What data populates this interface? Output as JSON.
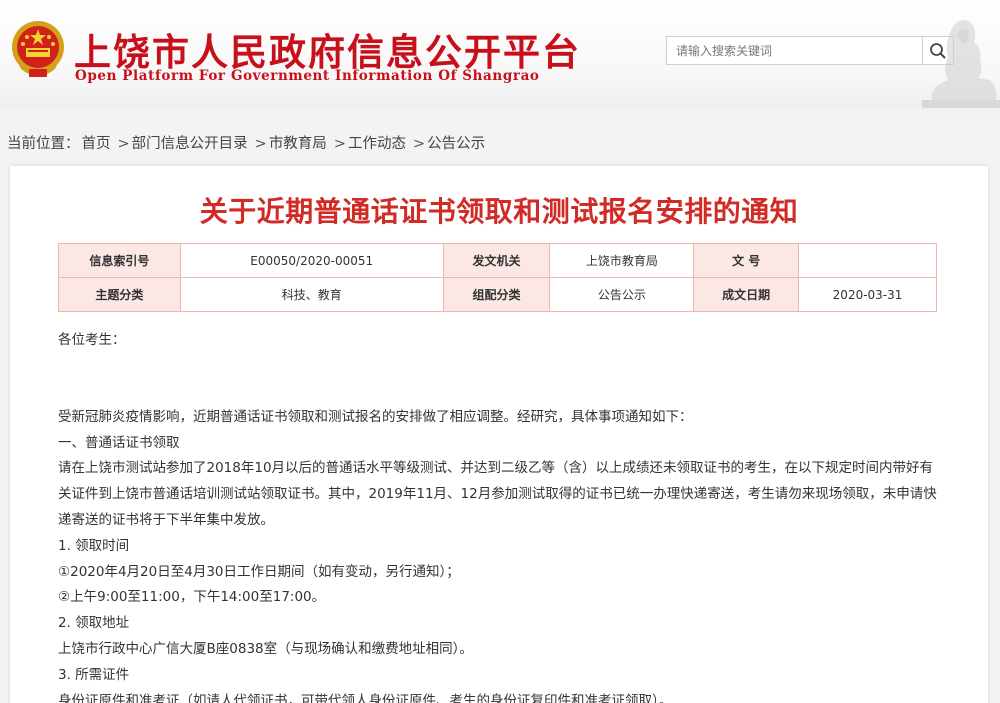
{
  "header": {
    "title": "上饶市人民政府信息公开平台",
    "subtitle": "Open Platform For Government Information Of Shangrao",
    "search_placeholder": "请输入搜索关键词",
    "colors": {
      "brand_red": "#c8101a"
    }
  },
  "breadcrumb": {
    "prefix": "当前位置：",
    "items": [
      "首页",
      "部门信息公开目录",
      "市教育局",
      "工作动态",
      "公告公示"
    ],
    "separator": ">"
  },
  "article": {
    "title": "关于近期普通话证书领取和测试报名安排的通知",
    "meta": [
      [
        {
          "label": "信息索引号",
          "value": "E00050/2020-00051"
        },
        {
          "label": "发文机关",
          "value": "上饶市教育局"
        },
        {
          "label": "文 号",
          "value": ""
        }
      ],
      [
        {
          "label": "主题分类",
          "value": "科技、教育"
        },
        {
          "label": "组配分类",
          "value": "公告公示"
        },
        {
          "label": "成文日期",
          "value": "2020-03-31"
        }
      ]
    ],
    "greeting": "各位考生：",
    "paragraphs": [
      "受新冠肺炎疫情影响，近期普通话证书领取和测试报名的安排做了相应调整。经研究，具体事项通知如下：",
      "一、普通话证书领取",
      "请在上饶市测试站参加了2018年10月以后的普通话水平等级测试、并达到二级乙等（含）以上成绩还未领取证书的考生，在以下规定时间内带好有关证件到上饶市普通话培训测试站领取证书。其中，2019年11月、12月参加测试取得的证书已统一办理快递寄送，考生请勿来现场领取，未申请快递寄送的证书将于下半年集中发放。",
      "1. 领取时间",
      "①2020年4月20日至4月30日工作日期间（如有变动，另行通知）；",
      "②上午9:00至11:00，下午14:00至17:00。",
      "2. 领取地址",
      "上饶市行政中心广信大厦B座0838室（与现场确认和缴费地址相同）。",
      "3. 所需证件",
      "身份证原件和准考证（如请人代领证书，可带代领人身份证原件、考生的身份证复印件和准考证领取）。"
    ],
    "colors": {
      "title_red": "#d12b26",
      "table_border": "#f0b7b0",
      "table_key_bg": "#fbe7e4"
    }
  },
  "icons": {
    "search": "search-icon",
    "emblem": "national-emblem-icon",
    "landmark": "landmark-statue-icon"
  }
}
